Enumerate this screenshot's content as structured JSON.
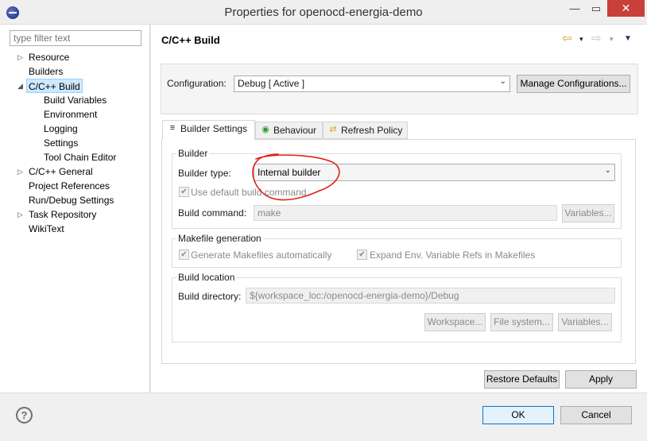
{
  "window": {
    "title": "Properties for openocd-energia-demo",
    "minimize_glyph": "—",
    "maximize_glyph": "▭",
    "close_glyph": "✕"
  },
  "filter": {
    "placeholder": "type filter text"
  },
  "tree": {
    "items": [
      {
        "label": "Resource",
        "expandable": true
      },
      {
        "label": "Builders",
        "expandable": false
      },
      {
        "label": "C/C++ Build",
        "expandable": true,
        "expanded": true,
        "selected": true
      },
      {
        "label": "Build Variables",
        "expandable": false
      },
      {
        "label": "Environment",
        "expandable": false
      },
      {
        "label": "Logging",
        "expandable": false
      },
      {
        "label": "Settings",
        "expandable": false
      },
      {
        "label": "Tool Chain Editor",
        "expandable": false
      },
      {
        "label": "C/C++ General",
        "expandable": true
      },
      {
        "label": "Project References",
        "expandable": false
      },
      {
        "label": "Run/Debug Settings",
        "expandable": false
      },
      {
        "label": "Task Repository",
        "expandable": true
      },
      {
        "label": "WikiText",
        "expandable": false
      }
    ]
  },
  "page": {
    "title": "C/C++ Build",
    "nav": {
      "back": "⇦",
      "forward": "⇨",
      "menu": "▼",
      "dropdown": "▾"
    }
  },
  "configuration": {
    "label": "Configuration:",
    "value": "Debug  [ Active ]",
    "manage_label": "Manage Configurations..."
  },
  "tabs": [
    {
      "label": "Builder Settings",
      "icon": "≡",
      "active": true
    },
    {
      "label": "Behaviour",
      "icon": "◉",
      "active": false
    },
    {
      "label": "Refresh Policy",
      "icon": "⇄",
      "active": false
    }
  ],
  "builder": {
    "group_label": "Builder",
    "type_label": "Builder type:",
    "type_value": "Internal builder",
    "use_default_label": "Use default build command",
    "use_default_checked": true,
    "command_label": "Build command:",
    "command_value": "make",
    "variables_label": "Variables..."
  },
  "makefile": {
    "group_label": "Makefile generation",
    "generate_label": "Generate Makefiles automatically",
    "generate_checked": true,
    "expand_label": "Expand Env. Variable Refs in Makefiles",
    "expand_checked": true
  },
  "location": {
    "group_label": "Build location",
    "dir_label": "Build directory:",
    "dir_value": "${workspace_loc:/openocd-energia-demo}/Debug",
    "workspace_label": "Workspace...",
    "filesystem_label": "File system...",
    "variables_label": "Variables..."
  },
  "buttons": {
    "restore": "Restore Defaults",
    "apply": "Apply",
    "ok": "OK",
    "cancel": "Cancel",
    "help": "?"
  },
  "colors": {
    "annotation": "#e0201a",
    "selection": "#cde8ff",
    "close_button": "#c7403a"
  },
  "check_glyph": "✔"
}
